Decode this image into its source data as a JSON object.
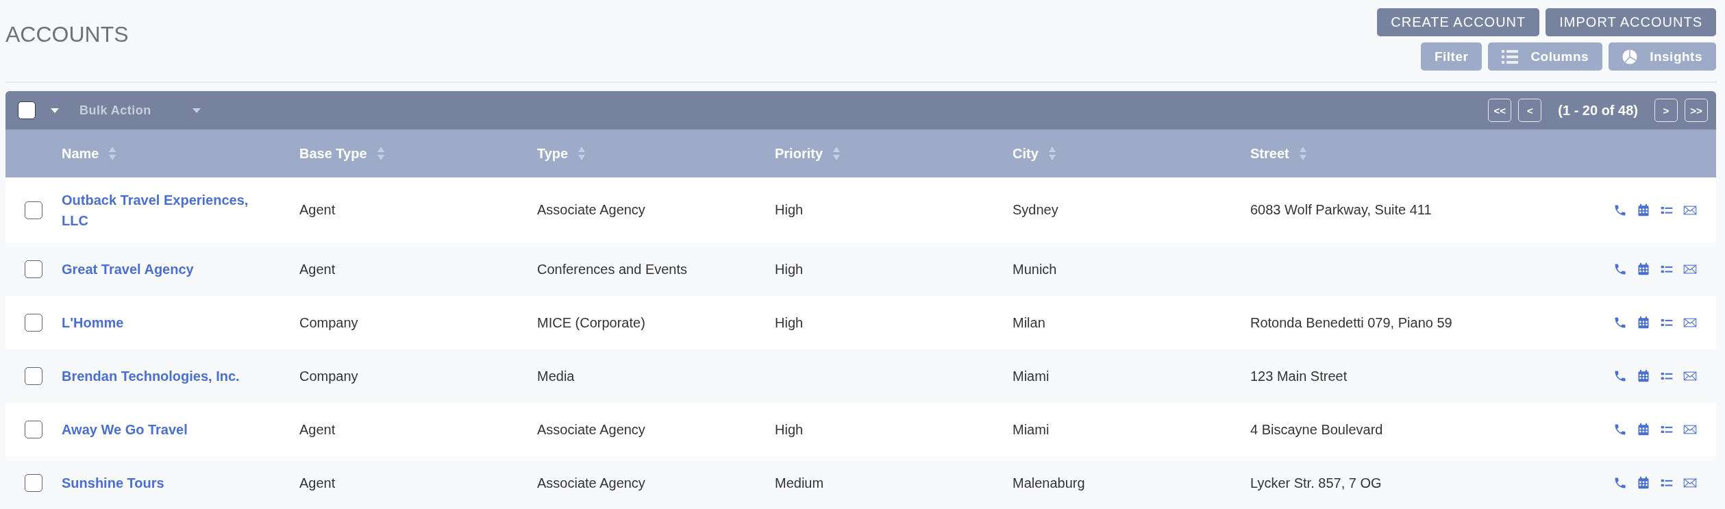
{
  "page": {
    "title": "ACCOUNTS"
  },
  "actions": [
    {
      "label": "CREATE ACCOUNT",
      "kind": "primary"
    },
    {
      "label": "IMPORT ACCOUNTS",
      "kind": "primary"
    },
    {
      "label": "Filter",
      "kind": "plain"
    },
    {
      "label": "Columns",
      "kind": "columns"
    },
    {
      "label": "Insights",
      "kind": "insights"
    }
  ],
  "toolbar": {
    "select_all": {
      "checked": false
    },
    "bulk_action": "Bulk Action",
    "pagination": {
      "first": "<<",
      "prev": "<",
      "range": "(1 - 20 of 48)",
      "next": ">",
      "last": ">>"
    }
  },
  "table": {
    "columns": [
      "Name",
      "Base Type",
      "Type",
      "Priority",
      "City",
      "Street"
    ],
    "rows": [
      {
        "checked": false,
        "cells": [
          "Outback Travel Experiences, LLC",
          "Agent",
          "Associate Agency",
          "High",
          "Sydney",
          "6083 Wolf Parkway, Suite 411"
        ]
      },
      {
        "checked": false,
        "cells": [
          "Great Travel Agency",
          "Agent",
          "Conferences and Events",
          "High",
          "Munich",
          ""
        ]
      },
      {
        "checked": false,
        "cells": [
          "L'Homme",
          "Company",
          "MICE (Corporate)",
          "High",
          "Milan",
          "Rotonda Benedetti 079, Piano 59"
        ]
      },
      {
        "checked": false,
        "cells": [
          "Brendan Technologies, Inc.",
          "Company",
          "Media",
          "",
          "Miami",
          "123 Main Street"
        ]
      },
      {
        "checked": false,
        "cells": [
          "Away We Go Travel",
          "Agent",
          "Associate Agency",
          "High",
          "Miami",
          "4 Biscayne Boulevard"
        ]
      },
      {
        "checked": false,
        "cells": [
          "Sunshine Tours",
          "Agent",
          "Associate Agency",
          "Medium",
          "Malenaburg",
          "Lycker Str. 857, 7 OG"
        ]
      }
    ]
  }
}
